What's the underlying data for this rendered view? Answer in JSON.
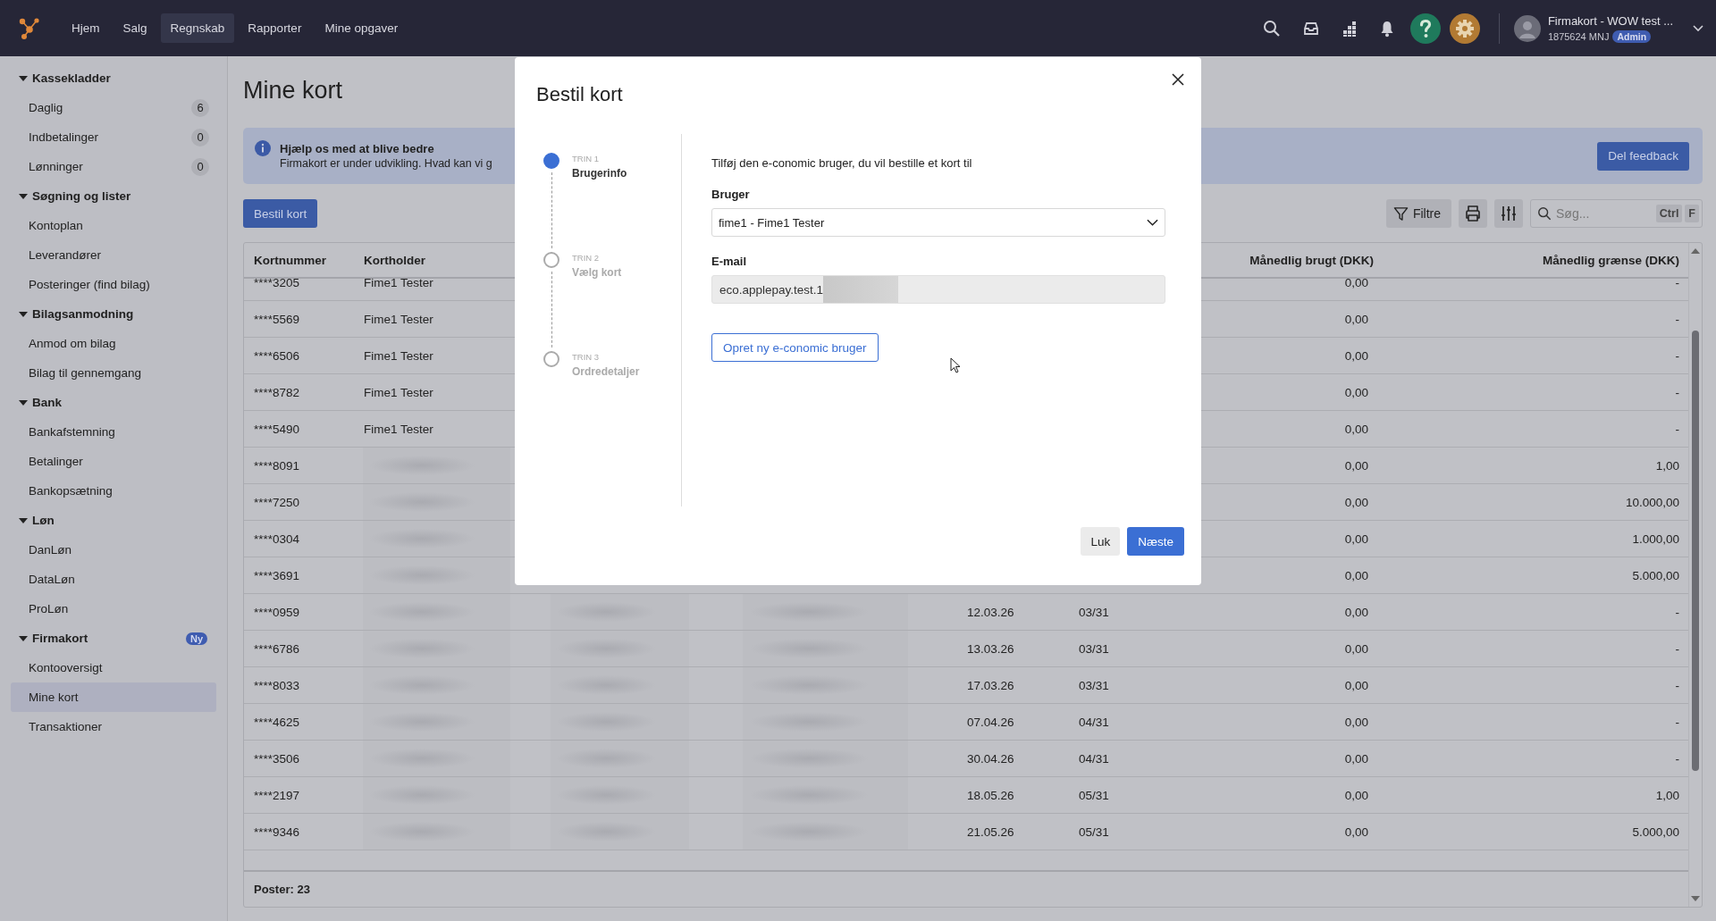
{
  "nav": {
    "items": [
      {
        "label": "Hjem",
        "selected": false
      },
      {
        "label": "Salg",
        "selected": false
      },
      {
        "label": "Regnskab",
        "selected": true
      },
      {
        "label": "Rapporter",
        "selected": false
      },
      {
        "label": "Mine opgaver",
        "selected": false
      }
    ],
    "user": {
      "company": "Firmakort - WOW test ...",
      "id": "1875624 MNJ",
      "role": "Admin"
    }
  },
  "sidebar": {
    "sections": [
      {
        "title": "Kassekladder",
        "expanded": true,
        "items": [
          {
            "label": "Daglig",
            "count": "6",
            "selected": false
          },
          {
            "label": "Indbetalinger",
            "count": "0",
            "selected": false
          },
          {
            "label": "Lønninger",
            "count": "0",
            "selected": false
          }
        ]
      },
      {
        "title": "Søgning og lister",
        "expanded": true,
        "items": [
          {
            "label": "Kontoplan",
            "selected": false
          },
          {
            "label": "Leverandører",
            "selected": false
          },
          {
            "label": "Posteringer (find bilag)",
            "selected": false
          }
        ]
      },
      {
        "title": "Bilagsanmodning",
        "expanded": true,
        "items": [
          {
            "label": "Anmod om bilag",
            "selected": false
          },
          {
            "label": "Bilag til gennemgang",
            "selected": false
          }
        ]
      },
      {
        "title": "Bank",
        "expanded": true,
        "items": [
          {
            "label": "Bankafstemning",
            "selected": false
          },
          {
            "label": "Betalinger",
            "selected": false
          },
          {
            "label": "Bankopsætning",
            "selected": false
          }
        ]
      },
      {
        "title": "Løn",
        "expanded": true,
        "items": [
          {
            "label": "DanLøn",
            "selected": false
          },
          {
            "label": "DataLøn",
            "selected": false
          },
          {
            "label": "ProLøn",
            "selected": false
          }
        ]
      },
      {
        "title": "Firmakort",
        "badge": "Ny",
        "expanded": true,
        "items": [
          {
            "label": "Kontooversigt",
            "selected": false
          },
          {
            "label": "Mine kort",
            "selected": true
          },
          {
            "label": "Transaktioner",
            "selected": false
          }
        ]
      }
    ]
  },
  "page": {
    "title": "Mine kort",
    "banner": {
      "title": "Hjælp os med at blive bedre",
      "text": "Firmakort er under udvikling. Hvad kan vi g",
      "button": "Del feedback"
    },
    "order_button": "Bestil kort",
    "toolbar": {
      "filter": "Filtre",
      "search_placeholder": "Søg...",
      "shortcut": [
        "Ctrl",
        "F"
      ]
    }
  },
  "table": {
    "columns": [
      "Kortnummer",
      "Kortholder",
      "Månedlig brugt (DKK)",
      "Månedlig grænse (DKK)"
    ],
    "rows": [
      {
        "number": "****3205",
        "holder": "Fime1 Tester",
        "redacted": false,
        "used": "0,00",
        "limit": "-"
      },
      {
        "number": "****5569",
        "holder": "Fime1 Tester",
        "redacted": false,
        "used": "0,00",
        "limit": "-"
      },
      {
        "number": "****6506",
        "holder": "Fime1 Tester",
        "redacted": false,
        "used": "0,00",
        "limit": "-"
      },
      {
        "number": "****8782",
        "holder": "Fime1 Tester",
        "redacted": false,
        "used": "0,00",
        "limit": "-"
      },
      {
        "number": "****5490",
        "holder": "Fime1 Tester",
        "redacted": false,
        "used": "0,00",
        "limit": "-"
      },
      {
        "number": "****8091",
        "redacted": true,
        "used": "0,00",
        "limit": "1,00"
      },
      {
        "number": "****7250",
        "redacted": true,
        "used": "0,00",
        "limit": "10.000,00"
      },
      {
        "number": "****0304",
        "redacted": true,
        "used": "0,00",
        "limit": "1.000,00"
      },
      {
        "number": "****3691",
        "redacted": true,
        "used": "0,00",
        "limit": "5.000,00"
      },
      {
        "number": "****0959",
        "redacted": true,
        "date": "12.03.26",
        "period": "03/31",
        "used": "0,00",
        "limit": "-"
      },
      {
        "number": "****6786",
        "redacted": true,
        "date": "13.03.26",
        "period": "03/31",
        "used": "0,00",
        "limit": "-"
      },
      {
        "number": "****8033",
        "redacted": true,
        "date": "17.03.26",
        "period": "03/31",
        "used": "0,00",
        "limit": "-"
      },
      {
        "number": "****4625",
        "redacted": true,
        "date": "07.04.26",
        "period": "04/31",
        "used": "0,00",
        "limit": "-"
      },
      {
        "number": "****3506",
        "redacted": true,
        "date": "30.04.26",
        "period": "04/31",
        "used": "0,00",
        "limit": "-"
      },
      {
        "number": "****2197",
        "redacted": true,
        "date": "18.05.26",
        "period": "05/31",
        "used": "0,00",
        "limit": "1,00"
      },
      {
        "number": "****9346",
        "redacted": true,
        "date": "21.05.26",
        "period": "05/31",
        "used": "0,00",
        "limit": "5.000,00"
      }
    ],
    "footer": "Poster: 23"
  },
  "dialog": {
    "title": "Bestil kort",
    "steps": [
      {
        "label": "TRIN 1",
        "title": "Brugerinfo",
        "selected": true
      },
      {
        "label": "TRIN 2",
        "title": "Vælg kort",
        "selected": false
      },
      {
        "label": "TRIN 3",
        "title": "Ordredetaljer",
        "selected": false
      }
    ],
    "intro": "Tilføj den e-conomic bruger, du vil bestille et kort til",
    "user_label": "Bruger",
    "user_value": "fime1 - Fime1 Tester",
    "email_label": "E-mail",
    "email_value": "eco.applepay.test.1",
    "email_redacted": true,
    "create_button": "Opret ny e-conomic bruger",
    "buttons": [
      "Luk",
      "Næste"
    ]
  }
}
